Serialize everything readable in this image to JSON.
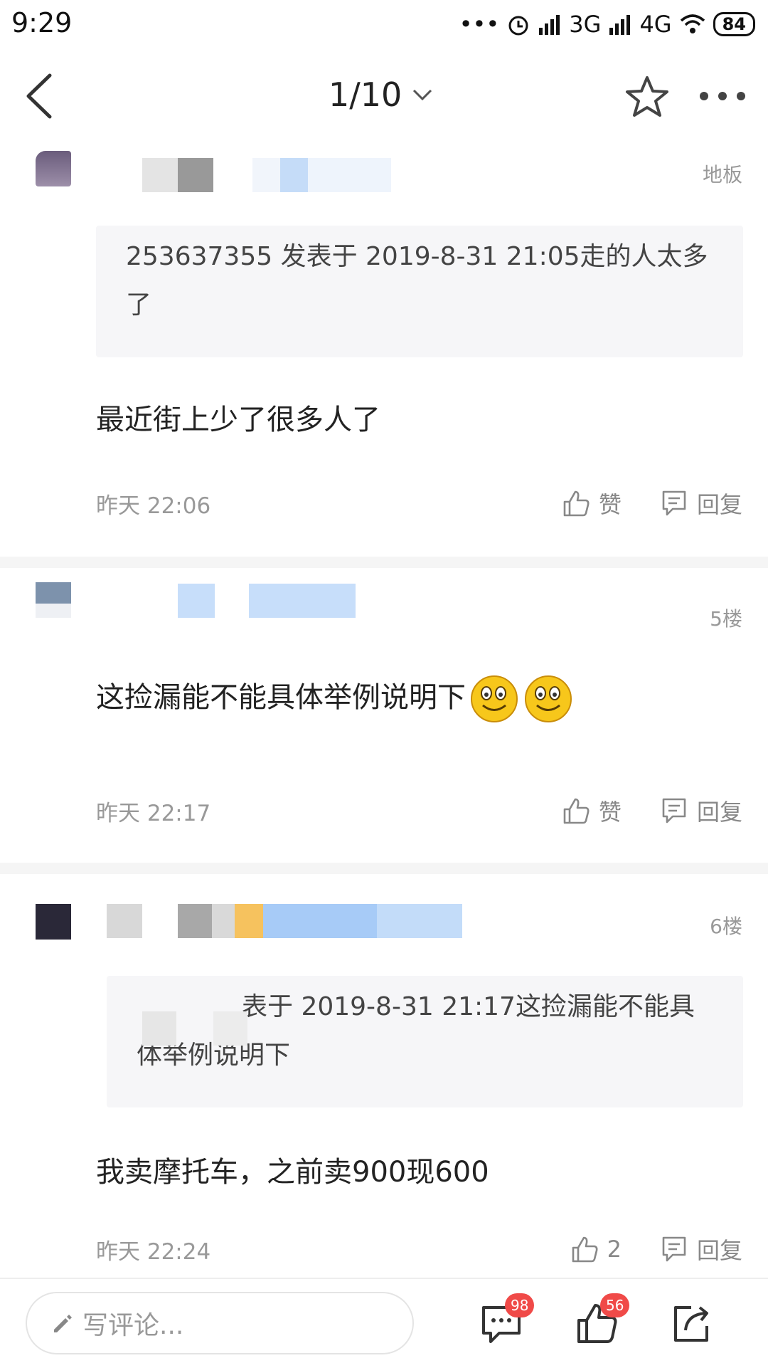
{
  "status_bar": {
    "time": "9:29",
    "network1": "3G",
    "network2": "4G",
    "battery": "84"
  },
  "header": {
    "page_indicator": "1/10",
    "icons": [
      "back-icon",
      "chevron-down-icon",
      "star-icon",
      "more-icon"
    ]
  },
  "posts": [
    {
      "floor": "地板",
      "quote": "253637355 发表于 2019-8-31 21:05走的人太多了",
      "content": "最近街上少了很多人了",
      "time": "昨天 22:06",
      "like_label": "赞",
      "reply_label": "回复"
    },
    {
      "floor": "5楼",
      "content": "这捡漏能不能具体举例说明下",
      "time": "昨天 22:17",
      "like_label": "赞",
      "reply_label": "回复"
    },
    {
      "floor": "6楼",
      "quote": "表于 2019-8-31 21:17这捡漏能不能具体举例说明下",
      "content": "我卖摩托车，之前卖900现600",
      "time": "昨天 22:24",
      "like_label": "2",
      "reply_label": "回复"
    }
  ],
  "bottom_bar": {
    "comment_placeholder": "写评论...",
    "comment_count": "98",
    "like_count": "56"
  },
  "colors": {
    "badge": "#f04a48",
    "muted_text": "#999999",
    "quote_bg": "#f6f6f8"
  }
}
